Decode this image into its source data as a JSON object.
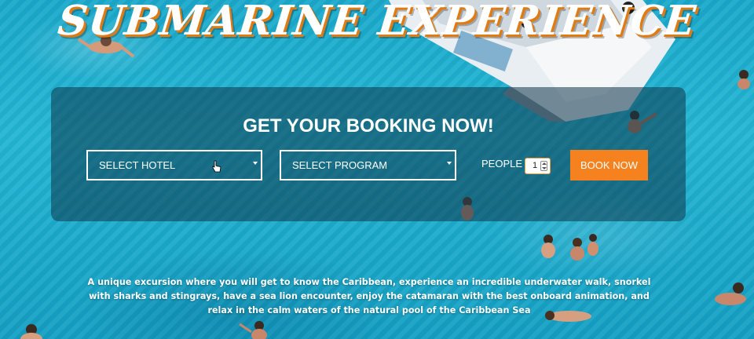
{
  "hero": {
    "title": "SUBMARINE EXPERIENCE",
    "title_accent_color": "#e07a12"
  },
  "booking": {
    "heading": "GET YOUR BOOKING NOW!",
    "hotel_select": {
      "selected": "SELECT HOTEL"
    },
    "program_select": {
      "selected": "SELECT PROGRAM"
    },
    "people": {
      "label": "PEOPLE",
      "value": "1"
    },
    "book_button": {
      "label": "BOOK NOW",
      "color": "#f5821f"
    }
  },
  "description": "A unique excursion where you will get to know the Caribbean, experience an incredible underwater walk, snorkel with sharks and stingrays, have a sea lion encounter, enjoy the catamaran with the best onboard animation, and relax in the calm waters of the natural pool of the Caribbean Sea"
}
